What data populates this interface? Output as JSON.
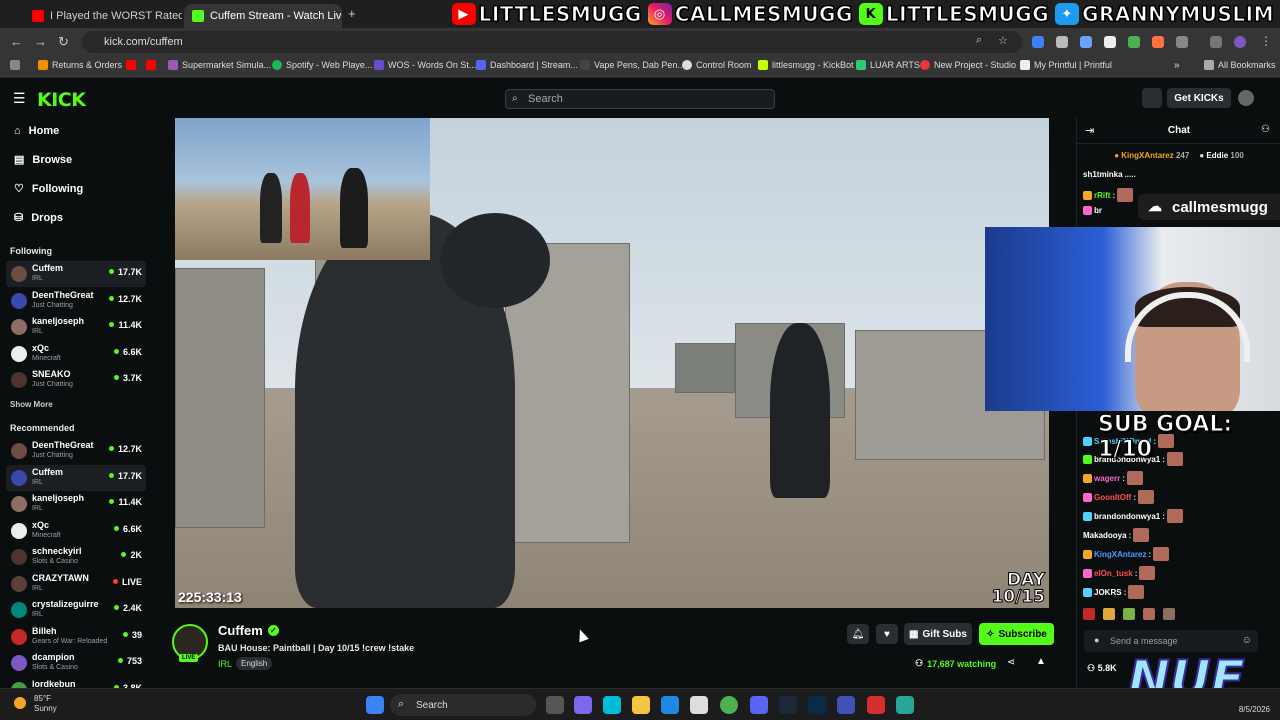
{
  "browser": {
    "tabs": [
      {
        "title": "I Played the WORST Rated Horr",
        "active": false
      },
      {
        "title": "Cuffem Stream - Watch Live",
        "active": true
      }
    ],
    "new_tab": "+",
    "url": "kick.com/cuffem",
    "bookmarks": [
      "Returns & Orders",
      "Supermarket Simula...",
      "Spotify - Web Playe...",
      "WOS - Words On St...",
      "Dashboard | Stream...",
      "Vape Pens, Dab Pen...",
      "Control Room",
      "littlesmugg - KickBot",
      "LUAR ARTS",
      "New Project - Studio",
      "My Printful | Printful"
    ],
    "all_bookmarks": "All Bookmarks"
  },
  "overlay": {
    "handles": [
      "LITTLESMUGG",
      "CALLMESMUGG",
      "LITTLESMUGG",
      "GRANNYMUSLIM"
    ],
    "cam_tag": "callmesmugg",
    "sub_goal": "SUB GOAL: 1/10",
    "logo": "NUE"
  },
  "kick": {
    "logo": "KICK",
    "search_placeholder": "Search",
    "get_kicks": "Get KICKs"
  },
  "sidebar": {
    "nav": [
      "Home",
      "Browse",
      "Following",
      "Drops"
    ],
    "following_header": "Following",
    "following": [
      {
        "name": "Cuffem",
        "category": "IRL",
        "viewers": "17.7K",
        "selected": true
      },
      {
        "name": "DeenTheGreat",
        "category": "Just Chatting",
        "viewers": "12.7K"
      },
      {
        "name": "kaneljoseph",
        "category": "IRL",
        "viewers": "11.4K"
      },
      {
        "name": "xQc",
        "category": "Minecraft",
        "viewers": "6.6K"
      },
      {
        "name": "SNEAKO",
        "category": "Just Chatting",
        "viewers": "3.7K"
      }
    ],
    "show_more": "Show More",
    "recommended_header": "Recommended",
    "recommended": [
      {
        "name": "DeenTheGreat",
        "category": "Just Chatting",
        "viewers": "12.7K"
      },
      {
        "name": "Cuffem",
        "category": "IRL",
        "viewers": "17.7K",
        "selected": true
      },
      {
        "name": "kaneljoseph",
        "category": "IRL",
        "viewers": "11.4K"
      },
      {
        "name": "xQc",
        "category": "Minecraft",
        "viewers": "6.6K"
      },
      {
        "name": "schneckyirl",
        "category": "Slots & Casino",
        "viewers": "2K"
      },
      {
        "name": "CRAZYTAWN",
        "category": "IRL",
        "viewers": "LIVE"
      },
      {
        "name": "crystalizeguirre",
        "category": "IRL",
        "viewers": "2.4K"
      },
      {
        "name": "Billeh",
        "category": "Gears of War: Reloaded",
        "viewers": "39"
      },
      {
        "name": "dcampion",
        "category": "Slots & Casino",
        "viewers": "753"
      },
      {
        "name": "lordkebun",
        "category": "",
        "viewers": "3.8K"
      }
    ]
  },
  "video": {
    "timestamp": "225:33:13",
    "day_line1": "DAY",
    "day_line2": "10/15"
  },
  "stream": {
    "live_badge": "LIVE",
    "streamer": "Cuffem",
    "title": "BAU House: Paintball | Day 10/15  !crew !stake",
    "category": "IRL",
    "language": "English",
    "gift_subs": "Gift Subs",
    "subscribe": "Subscribe",
    "watching": "17,687 watching"
  },
  "chat": {
    "header": "Chat",
    "pinned": [
      {
        "name": "KingXAntarez",
        "count": "247"
      },
      {
        "name": "Eddie",
        "count": "100"
      }
    ],
    "messages": [
      {
        "user": "sh1tminka",
        "text": ".....",
        "color": "#ffffff"
      },
      {
        "user": "rRift",
        "text": ":",
        "color": "#53fc18"
      },
      {
        "user": "br",
        "text": "",
        "color": "#ffffff"
      },
      {
        "user": "SatoshiNOmad",
        "text": ":",
        "color": "#4fd1ff"
      },
      {
        "user": "brandondonwya1",
        "text": ":",
        "color": "#ffffff"
      },
      {
        "user": "wagerr",
        "text": ":",
        "color": "#ff66cc"
      },
      {
        "user": "GoonItOff",
        "text": ":",
        "color": "#ff4f4f"
      },
      {
        "user": "brandondonwya1",
        "text": ":",
        "color": "#ffffff"
      },
      {
        "user": "Makadooya",
        "text": ":",
        "color": "#ffffff"
      },
      {
        "user": "KingXAntarez",
        "text": ":",
        "color": "#4f9dff"
      },
      {
        "user": "elOn_tusk",
        "text": ":",
        "color": "#ff4f4f"
      },
      {
        "user": "JOKRS",
        "text": ":",
        "color": "#ffffff"
      }
    ],
    "input_placeholder": "Send a message",
    "kicks_count": "5.8K"
  },
  "taskbar": {
    "temp": "85°F",
    "condition": "Sunny",
    "search": "Search",
    "date": "8/5/2026"
  },
  "colors": {
    "accent": "#53fc18",
    "bg": "#0b0e0f"
  }
}
